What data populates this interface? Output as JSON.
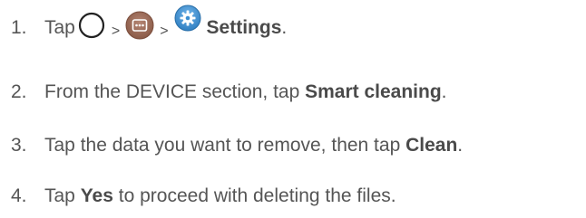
{
  "steps": [
    {
      "number": "1.",
      "text_before": "Tap",
      "icons": [
        "home-circle-icon",
        "apps-icon",
        "settings-gear-icon"
      ],
      "separator": ">",
      "bold": "Settings",
      "text_after": "."
    },
    {
      "number": "2.",
      "text_before": "From the DEVICE section, tap ",
      "bold": "Smart cleaning",
      "text_after": "."
    },
    {
      "number": "3.",
      "text_before": "Tap the data you want to remove, then tap ",
      "bold": "Clean",
      "text_after": "."
    },
    {
      "number": "4.",
      "text_before": "Tap ",
      "bold": "Yes",
      "text_after": " to proceed with deleting the files."
    }
  ],
  "colors": {
    "text": "#555555",
    "apps_icon": "#9b6b57",
    "settings_icon": "#3d8fd1"
  }
}
